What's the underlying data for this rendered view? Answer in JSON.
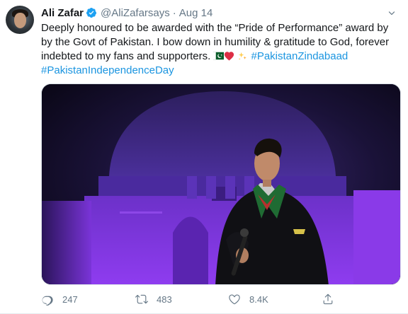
{
  "tweet": {
    "author_name": "Ali Zafar",
    "handle": "@AliZafarsays",
    "separator": "·",
    "time": "Aug 14",
    "text_line1": "Deeply honoured to be awarded with the “Pride of Performance” award by",
    "text_line2": "by the Govt of Pakistan. I bow down in humility & gratitude to God, forever",
    "text_line3_prefix": "indebted to my fans and supporters.",
    "emoji": [
      "pakistan-flag",
      "red-heart",
      "sparkle"
    ],
    "hashtag1": "#PakistanZindabaad",
    "hashtag2": "#PakistanIndependenceDay",
    "media": {
      "icon": "photo-singer-on-stage"
    },
    "actions": {
      "reply_count": "247",
      "retweet_count": "483",
      "like_count": "8.4K"
    }
  },
  "colors": {
    "text": "#14171a",
    "secondary": "#657786",
    "link": "#1b95e0",
    "verified": "#1da1f2",
    "stage_purple": "#7a2fd6"
  }
}
